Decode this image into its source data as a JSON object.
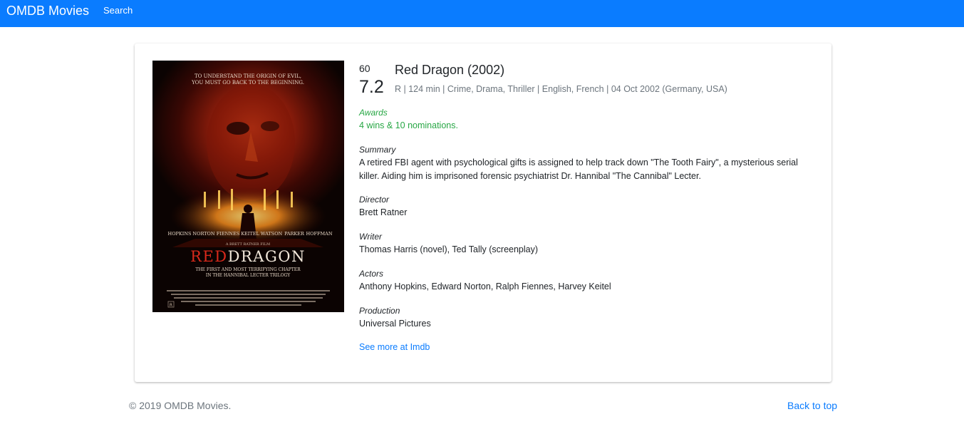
{
  "navbar": {
    "brand": "OMDB Movies",
    "search_link": "Search",
    "background_color": "#0a7cff"
  },
  "movie": {
    "metascore": "60",
    "imdb_rating": "7.2",
    "title": "Red Dragon (2002)",
    "meta_line": "R | 124 min | Crime, Drama, Thriller | English, French | 04 Oct 2002 (Germany, USA)",
    "poster": {
      "tagline_1": "TO UNDERSTAND THE ORIGIN OF EVIL,",
      "tagline_2": "YOU MUST GO BACK TO THE BEGINNING.",
      "cast_names": [
        "HOPKINS",
        "NORTON",
        "FIENNES",
        "KEITEL",
        "WATSON",
        "PARKER",
        "HOFFMAN"
      ],
      "credit_line": "A BRETT RATNER FILM",
      "title_red": "RED",
      "title_white": "DRAGON",
      "sub_1": "THE FIRST AND MOST TERRIFYING CHAPTER",
      "sub_2": "IN THE HANNIBAL LECTER TRILOGY",
      "rating_badge": "R"
    },
    "sections": {
      "awards": {
        "label": "Awards",
        "value": "4 wins & 10 nominations."
      },
      "summary": {
        "label": "Summary",
        "value": "A retired FBI agent with psychological gifts is assigned to help track down \"The Tooth Fairy\", a mysterious serial killer. Aiding him is imprisoned forensic psychiatrist Dr. Hannibal \"The Cannibal\" Lecter."
      },
      "director": {
        "label": "Director",
        "value": "Brett Ratner"
      },
      "writer": {
        "label": "Writer",
        "value": "Thomas Harris (novel), Ted Tally (screenplay)"
      },
      "actors": {
        "label": "Actors",
        "value": "Anthony Hopkins, Edward Norton, Ralph Fiennes, Harvey Keitel"
      },
      "production": {
        "label": "Production",
        "value": "Universal Pictures"
      }
    },
    "imdb_link": "See more at Imdb"
  },
  "footer": {
    "copyright": "© 2019 OMDB Movies.",
    "back_to_top": "Back to top"
  },
  "colors": {
    "accent": "#0a7cff",
    "awards_green": "#28a745",
    "muted": "#6c757d"
  }
}
